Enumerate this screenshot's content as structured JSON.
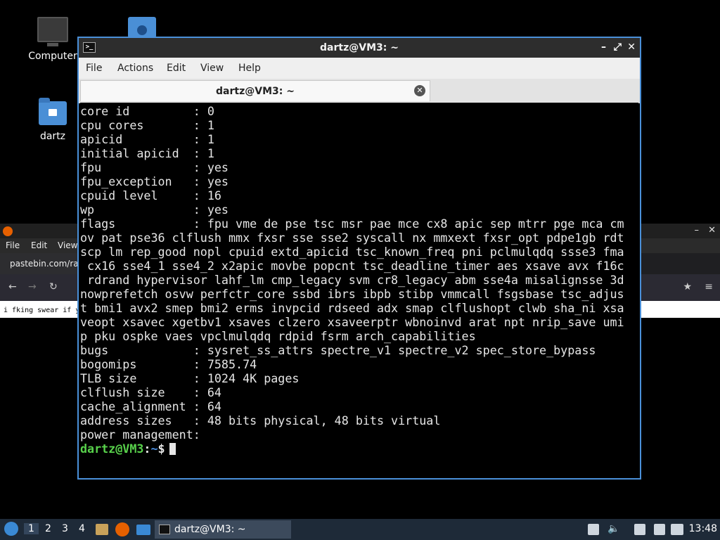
{
  "desktop": {
    "icons": [
      {
        "label": "Computer"
      },
      {
        "label": "dartz"
      }
    ]
  },
  "firefox": {
    "menu": [
      "File",
      "Edit",
      "View"
    ],
    "tab_title": "pastebin.com/ra",
    "page_text": "i fking swear if y"
  },
  "terminal": {
    "title": "dartz@VM3: ~",
    "menu": [
      "File",
      "Actions",
      "Edit",
      "View",
      "Help"
    ],
    "tab_label": "dartz@VM3: ~",
    "output": "core id         : 0\ncpu cores       : 1\napicid          : 1\ninitial apicid  : 1\nfpu             : yes\nfpu_exception   : yes\ncpuid level     : 16\nwp              : yes\nflags           : fpu vme de pse tsc msr pae mce cx8 apic sep mtrr pge mca cm\nov pat pse36 clflush mmx fxsr sse sse2 syscall nx mmxext fxsr_opt pdpe1gb rdt\nscp lm rep_good nopl cpuid extd_apicid tsc_known_freq pni pclmulqdq ssse3 fma\n cx16 sse4_1 sse4_2 x2apic movbe popcnt tsc_deadline_timer aes xsave avx f16c\n rdrand hypervisor lahf_lm cmp_legacy svm cr8_legacy abm sse4a misalignsse 3d\nnowprefetch osvw perfctr_core ssbd ibrs ibpb stibp vmmcall fsgsbase tsc_adjus\nt bmi1 avx2 smep bmi2 erms invpcid rdseed adx smap clflushopt clwb sha_ni xsa\nveopt xsavec xgetbv1 xsaves clzero xsaveerptr wbnoinvd arat npt nrip_save umi\np pku ospke vaes vpclmulqdq rdpid fsrm arch_capabilities\nbugs            : sysret_ss_attrs spectre_v1 spectre_v2 spec_store_bypass\nbogomips        : 7585.74\nTLB size        : 1024 4K pages\nclflush size    : 64\ncache_alignment : 64\naddress sizes   : 48 bits physical, 48 bits virtual\npower management:\n",
    "prompt": {
      "user": "dartz@VM3",
      "sep": ":",
      "path": "~",
      "symbol": "$"
    }
  },
  "taskbar": {
    "workspaces": [
      "1",
      "2",
      "3",
      "4"
    ],
    "task_label": "dartz@VM3: ~",
    "clock": "13:48"
  }
}
